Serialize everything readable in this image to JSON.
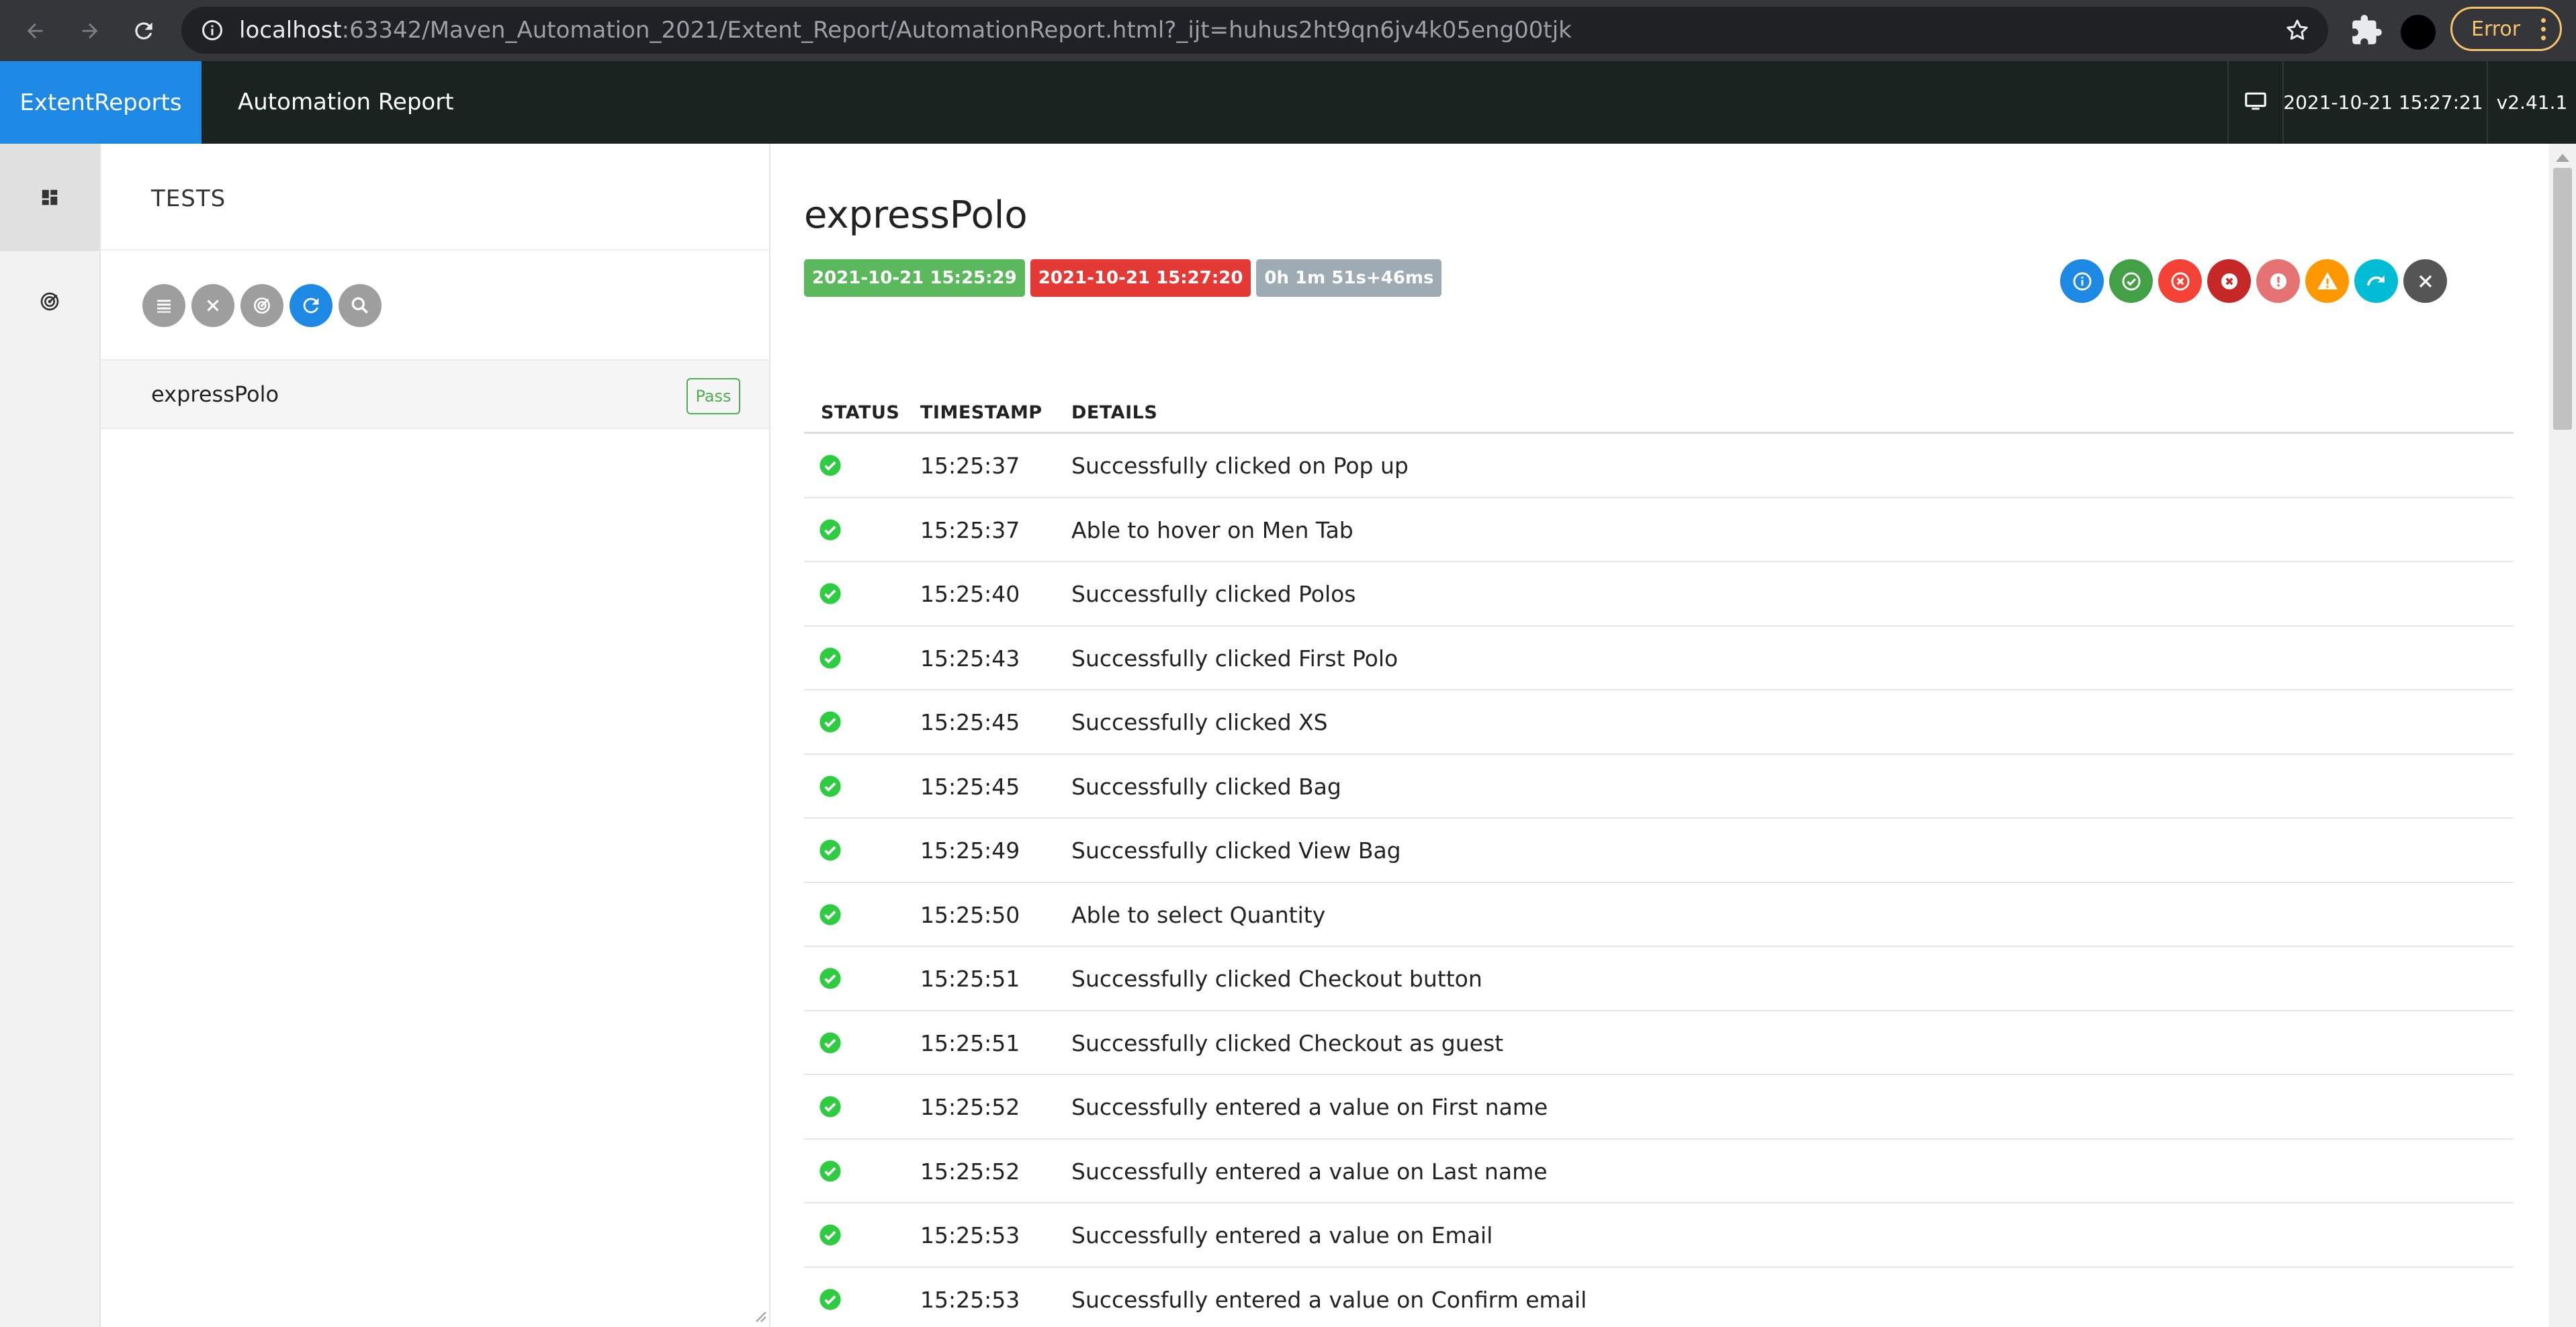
{
  "browser": {
    "url_host": "localhost",
    "url_rest": ":63342/Maven_Automation_2021/Extent_Report/AutomationReport.html?_ijt=huhus2ht9qn6jv4k05eng00tjk",
    "error_label": "Error"
  },
  "header": {
    "brand": "ExtentReports",
    "report_name": "Automation Report",
    "date": "2021-10-21 15:27:21",
    "version": "v2.41.1"
  },
  "tests_panel": {
    "title": "TESTS",
    "toolbar": [
      "list-icon",
      "close-icon",
      "radar-icon",
      "refresh-icon",
      "search-icon"
    ],
    "items": [
      {
        "name": "expressPolo",
        "status": "Pass"
      }
    ]
  },
  "test": {
    "name": "expressPolo",
    "start_time": "2021-10-21 15:25:29",
    "end_time": "2021-10-21 15:27:20",
    "duration": "0h 1m 51s+46ms",
    "colors": {
      "start": "#5cb85c",
      "end": "#e53935",
      "duration": "#9eabb4",
      "pass": "#2ecc40"
    },
    "filters": [
      {
        "icon": "info-icon",
        "color": "#1e88e5"
      },
      {
        "icon": "pass-icon",
        "color": "#43a047"
      },
      {
        "icon": "fail-icon",
        "color": "#f44336"
      },
      {
        "icon": "fatal-icon",
        "color": "#c62828"
      },
      {
        "icon": "error-icon",
        "color": "#e57373"
      },
      {
        "icon": "warning-icon",
        "color": "#ff9800"
      },
      {
        "icon": "skip-icon",
        "color": "#00bcd4"
      },
      {
        "icon": "clear-icon",
        "color": "#555555"
      }
    ]
  },
  "log": {
    "columns": [
      "STATUS",
      "TIMESTAMP",
      "DETAILS"
    ],
    "rows": [
      {
        "status": "pass",
        "timestamp": "15:25:37",
        "details": "Successfully clicked on Pop up"
      },
      {
        "status": "pass",
        "timestamp": "15:25:37",
        "details": "Able to hover on Men Tab"
      },
      {
        "status": "pass",
        "timestamp": "15:25:40",
        "details": "Successfully clicked Polos"
      },
      {
        "status": "pass",
        "timestamp": "15:25:43",
        "details": "Successfully clicked First Polo"
      },
      {
        "status": "pass",
        "timestamp": "15:25:45",
        "details": "Successfully clicked XS"
      },
      {
        "status": "pass",
        "timestamp": "15:25:45",
        "details": "Successfully clicked Bag"
      },
      {
        "status": "pass",
        "timestamp": "15:25:49",
        "details": "Successfully clicked View Bag"
      },
      {
        "status": "pass",
        "timestamp": "15:25:50",
        "details": "Able to select Quantity"
      },
      {
        "status": "pass",
        "timestamp": "15:25:51",
        "details": "Successfully clicked Checkout button"
      },
      {
        "status": "pass",
        "timestamp": "15:25:51",
        "details": "Successfully clicked Checkout as guest"
      },
      {
        "status": "pass",
        "timestamp": "15:25:52",
        "details": "Successfully entered a value on First name"
      },
      {
        "status": "pass",
        "timestamp": "15:25:52",
        "details": "Successfully entered a value on Last name"
      },
      {
        "status": "pass",
        "timestamp": "15:25:53",
        "details": "Successfully entered a value on Email"
      },
      {
        "status": "pass",
        "timestamp": "15:25:53",
        "details": "Successfully entered a value on Confirm email"
      }
    ]
  }
}
